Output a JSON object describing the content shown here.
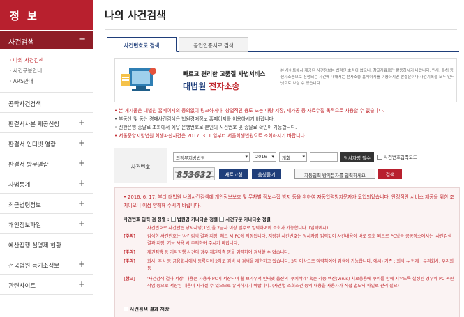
{
  "sidebar": {
    "title": "정 보",
    "active": {
      "label": "사건검색",
      "toggle": "−"
    },
    "sub_items": [
      "· 나의 사건검색",
      "· 사건구분안내",
      "· ARS안내"
    ],
    "items": [
      {
        "label": "공탁사건검색",
        "toggle": ""
      },
      {
        "label": "판결서사본 제공신청",
        "toggle": "+"
      },
      {
        "label": "판결서 인터넷 열람",
        "toggle": "+"
      },
      {
        "label": "판결서 방문열람",
        "toggle": "+"
      },
      {
        "label": "사법통계",
        "toggle": "+"
      },
      {
        "label": "최근법령정보",
        "toggle": "+"
      },
      {
        "label": "개인정보파일",
        "toggle": "+"
      },
      {
        "label": "예산집행 실명제 현황",
        "toggle": ""
      },
      {
        "label": "전국법원·등기소정보",
        "toggle": "+"
      },
      {
        "label": "관련사이트",
        "toggle": "+"
      }
    ]
  },
  "page": {
    "title": "나의 사건검색"
  },
  "tabs": [
    "사건번호로 검색",
    "공인인증서로 검색"
  ],
  "banner": {
    "tagline": "빠르고 편리한 고품질 사법서비스",
    "brand_prefix": "대법원",
    "brand_suffix": "전자소송",
    "desc": "본 사이트에서 제공된 사건정보는 법적인 효력이 없으니, 참고자료로만 활용하시기 바랍니다. 민사, 특허 등 전자소송으로 진행되는 사건에 대해서는 전자소송 홈페이지를 이용하시면 판결문이나 사건기록을 모두 인터넷으로 보실 수 있습니다."
  },
  "notes": [
    "본 게시물은 대법원 홈페이지의 동의없이 링크하거나, 상업적인 용도 또는 다량 저장, 재가공 등 자료수집 목적으로 사용할 수 없습니다.",
    "부동산 및 동산 경매사건검색은 법원경매정보 홈페이지를 이용하시기 바랍니다.",
    "신한은행 송달료 조회에서 예납 은행번호로 본인의 사건번호 및 송달료 확인이 가능합니다.",
    "서울중앙지방법원 회생파산사건은 2017. 3. 1.일부터 서울회생법원으로 조회하시기 바랍니다."
  ],
  "form": {
    "label": "사건번호",
    "court": "의정부지방법원",
    "year": "2016",
    "type": "개회",
    "party_button": "당사자명 필수",
    "case_number_mode": "사건번호입력모드",
    "captcha_text": "853632",
    "refresh_button": "새로고침",
    "audio_button": "음성듣기",
    "captcha_placeholder": "자동입력 방지문자를 입력하세요",
    "search_button": "검색"
  },
  "info": {
    "top": "2016. 6. 17. 부터 대법원 나의사건검색에 개인정보보호 및 무차별 정보수집 방지 등을 위하여 자동입력방지문자가 도입되었습니다. 안정적인 서비스 제공을 위한 조치이오니 이점 양해해 주시기 바랍니다.",
    "option_title": "사건번호 입력 검 정렬 :",
    "option_a": "법원명 가나다순 정렬",
    "option_b": "사건구분 가나다순 정렬",
    "rows": [
      {
        "tag": "",
        "text": "사건번호로 사건관련 당사자명(1인)을 2글자 이상 필수로 입력하여야 조회가 가능합니다. (입력예시)"
      },
      {
        "tag": "[주의]",
        "text": "검색한 사건번호는 '사건검색 결과 저장' 체크 시 PC에 저장됩니다. 저장된 사건번호는 당사자명 입력없이 사건내용이 바로 조회 되므로 PC방등 공공장소에서는 '사건검색 결과 저장' 기능 사용 시 주의하여 주시기 바랍니다."
      },
      {
        "tag": "[주의]",
        "text": "재권집행 등 기타집행 사건의 경우 채권자측 명을 입력하여 검색할 수 없습니다."
      },
      {
        "tag": "[주의]",
        "text": "회사, 주식 등 금융회사에서 등록되어 2차로 검색 시 검색을 제한하고 있습니다. 3자 이상으로 입력하여야 검색이 가능합니다. 예시) 기존 : 회사 → 현재 : 우리회사, 우리회 등"
      },
      {
        "tag": "[참고]",
        "text": "'사건검색 결과 저장' 내용은 사용자 PC에 저장되며 웹 브라우저 인터넷 옵션의 '쿠키삭제' 혹은 각종 백신(Virus) 치료응용에 쿠키를 함께 지우도록 설정된 경우와 PC 복원작업 등으로 저장된 내용이 사라질 수 있으므로 유의하시기 바랍니다. (사건별 조회조건 등의 내용을 사용자가 직접 별도의 파일로 관리 필요)"
      }
    ],
    "save_label": "사건검색 결과 저장"
  }
}
